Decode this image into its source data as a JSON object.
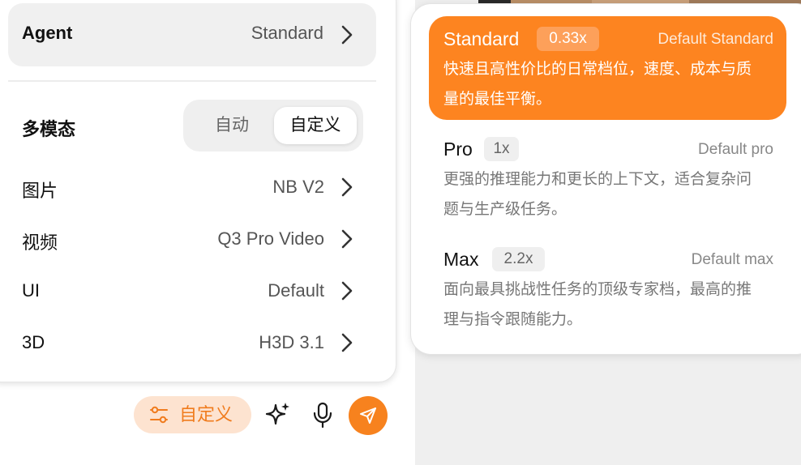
{
  "settings": {
    "agent": {
      "label": "Agent",
      "value": "Standard"
    },
    "multimodal": {
      "label": "多模态",
      "options": [
        "自动",
        "自定义"
      ],
      "selected": "自定义"
    },
    "rows": [
      {
        "label": "图片",
        "value": "NB V2"
      },
      {
        "label": "视频",
        "value": "Q3 Pro Video"
      },
      {
        "label": "UI",
        "value": "Default"
      },
      {
        "label": "3D",
        "value": "H3D 3.1"
      }
    ]
  },
  "toolbar": {
    "custom_label": "自定义",
    "icons": [
      "sliders-icon",
      "sparkle-icon",
      "microphone-icon",
      "send-icon"
    ]
  },
  "tiers": [
    {
      "name": "Standard",
      "multiplier": "0.33x",
      "default_label": "Default Standard",
      "desc_lines": [
        "快速且高性价比的日常档位，速度、成本与质",
        "量的最佳平衡。"
      ],
      "selected": true
    },
    {
      "name": "Pro",
      "multiplier": "1x",
      "default_label": "Default pro",
      "desc_lines": [
        "更强的推理能力和更长的上下文，适合复杂问",
        "题与生产级任务。"
      ],
      "selected": false
    },
    {
      "name": "Max",
      "multiplier": "2.2x",
      "default_label": "Default max",
      "desc_lines": [
        "面向最具挑战性任务的顶级专家档，最高的推",
        "理与指令跟随能力。"
      ],
      "selected": false
    }
  ],
  "colors": {
    "accent": "#fd8420",
    "accent_light": "#fde3d0"
  }
}
